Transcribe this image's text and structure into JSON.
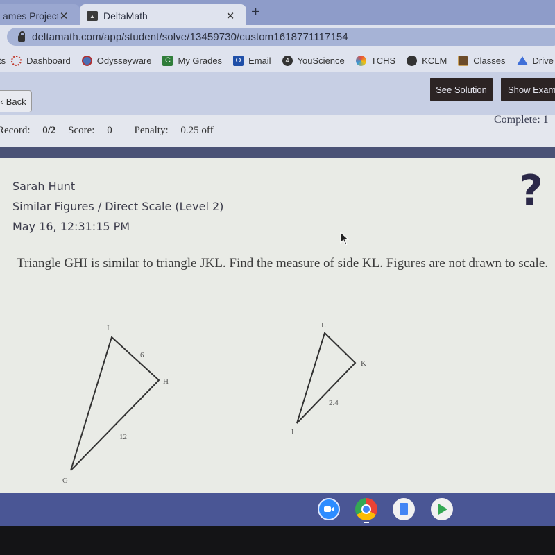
{
  "browser": {
    "tabs": [
      {
        "title": "ames Project",
        "active": false
      },
      {
        "title": "DeltaMath",
        "active": true
      }
    ],
    "url": "deltamath.com/app/student/solve/13459730/custom1618771117154",
    "bookmarks": [
      {
        "label": "ts",
        "icon": "partial"
      },
      {
        "label": "Dashboard",
        "icon": "canvas-icon"
      },
      {
        "label": "Odysseyware",
        "icon": "odysseyware-icon"
      },
      {
        "label": "My Grades",
        "icon": "grades-icon"
      },
      {
        "label": "Email",
        "icon": "outlook-icon"
      },
      {
        "label": "YouScience",
        "icon": "youscience-icon"
      },
      {
        "label": "TCHS",
        "icon": "tchs-icon"
      },
      {
        "label": "KCLM",
        "icon": "kclm-icon"
      },
      {
        "label": "Classes",
        "icon": "classroom-icon"
      },
      {
        "label": "Drive",
        "icon": "drive-icon"
      }
    ]
  },
  "toolbar": {
    "back_label": "Back",
    "see_solution_label": "See Solution",
    "show_example_label": "Show Examp"
  },
  "status": {
    "record_label": "Record:",
    "record_value": "0/2",
    "score_label": "Score:",
    "score_value": "0",
    "penalty_label": "Penalty:",
    "penalty_value": "0.25 off",
    "complete_label": "Complete: 1"
  },
  "problem": {
    "student_name": "Sarah Hunt",
    "topic": "Similar Figures / Direct Scale (Level 2)",
    "timestamp": "May 16, 12:31:15 PM",
    "help_symbol": "?",
    "question": "Triangle GHI is similar to triangle JKL. Find the measure of side KL. Figures are not drawn to scale."
  },
  "figure": {
    "triangle1": {
      "vertices": {
        "G": "G",
        "H": "H",
        "I": "I"
      },
      "sides": {
        "IH": "6",
        "GH": "12"
      }
    },
    "triangle2": {
      "vertices": {
        "J": "J",
        "K": "K",
        "L": "L"
      },
      "sides": {
        "JK": "2.4"
      }
    }
  },
  "dock": [
    {
      "name": "Zoom",
      "color": "#2d8cff"
    },
    {
      "name": "Chrome",
      "color": "#4285f4"
    },
    {
      "name": "Docs",
      "color": "#4285f4"
    },
    {
      "name": "Play Store",
      "color": "#34a853"
    }
  ]
}
